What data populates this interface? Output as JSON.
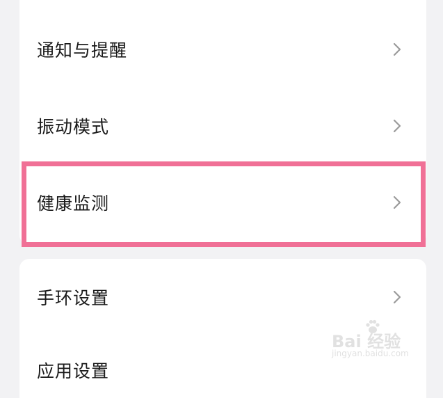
{
  "settings": {
    "group1": [
      {
        "label": "通知与提醒"
      },
      {
        "label": "振动模式"
      },
      {
        "label": "健康监测"
      }
    ],
    "group2": [
      {
        "label": "手环设置"
      },
      {
        "label": "应用设置"
      }
    ]
  },
  "highlight": {
    "target": "健康监测",
    "color": "#f07096"
  },
  "watermark": {
    "logo": "Bai  经验",
    "url": "jingyan.baidu.com"
  },
  "icons": {
    "row_chevron": "chevron-right-icon"
  }
}
